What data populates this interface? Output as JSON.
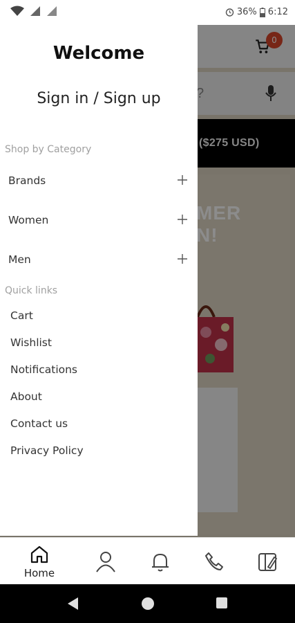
{
  "status_bar": {
    "battery": "36%",
    "time": "6:12"
  },
  "background": {
    "cart_count": "0",
    "search_fragment": "?",
    "promo_text": "($275 USD)",
    "banner_text_line1": "MER",
    "banner_text_line2": "N!"
  },
  "drawer": {
    "title": "Welcome",
    "sign_in": "Sign in / Sign up",
    "shop_by_category_label": "Shop by Category",
    "categories": [
      {
        "label": "Brands"
      },
      {
        "label": "Women"
      },
      {
        "label": "Men"
      }
    ],
    "quick_links_label": "Quick links",
    "quick_links": [
      {
        "label": "Cart"
      },
      {
        "label": "Wishlist"
      },
      {
        "label": "Notifications"
      },
      {
        "label": "About"
      },
      {
        "label": "Contact us"
      },
      {
        "label": "Privacy Policy"
      }
    ]
  },
  "bottom_nav": {
    "items": [
      {
        "label": "Home",
        "icon": "home-icon",
        "active": true
      },
      {
        "label": "",
        "icon": "user-icon"
      },
      {
        "label": "",
        "icon": "bell-icon"
      },
      {
        "label": "",
        "icon": "phone-icon"
      },
      {
        "label": "",
        "icon": "catalog-icon"
      }
    ]
  },
  "colors": {
    "badge": "#d9462b",
    "overlay": "rgba(0,0,0,0.45)",
    "muted_text": "#a0a0a0"
  }
}
